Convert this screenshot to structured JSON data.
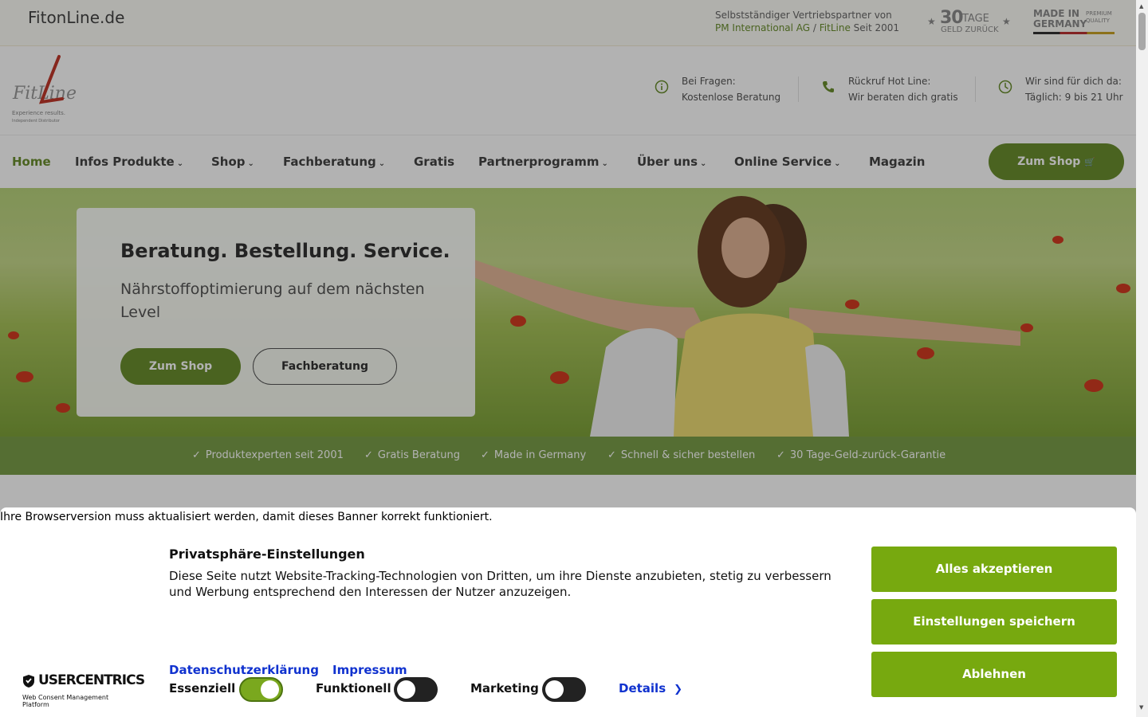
{
  "topbar": {
    "site_name": "FitonLine.de",
    "partner_line1": "Selbstständiger Vertriebspartner von",
    "partner_company": "PM International AG",
    "partner_sep": " / ",
    "partner_brand": "FitLine",
    "partner_since": " Seit 2001",
    "badge30_number": "30",
    "badge30_days": "TAGE",
    "badge30_sub": "GELD ZURÜCK",
    "made_in_l1": "MADE IN",
    "made_in_l2": "GERMANY",
    "made_in_pq1": "PREMIUM",
    "made_in_pq2": "QUALITY"
  },
  "logo": {
    "brand": "FitLine",
    "tagline1": "Experience results.",
    "tagline2": "Independent Distributor"
  },
  "header": {
    "info": [
      {
        "label": "Bei Fragen:",
        "value": "Kostenlose Beratung",
        "icon": "info-icon"
      },
      {
        "label": "Rückruf Hot Line:",
        "value": "Wir beraten dich gratis",
        "icon": "phone-icon"
      },
      {
        "label": "Wir sind für dich da:",
        "value": "Täglich: 9 bis 21 Uhr",
        "icon": "clock-icon"
      }
    ]
  },
  "nav": {
    "items": [
      {
        "label": "Home"
      },
      {
        "label": "Infos Produkte",
        "chevron": "⌄"
      },
      {
        "label": "Shop",
        "chevron": "⌄"
      },
      {
        "label": "Fachberatung",
        "chevron": "⌄"
      },
      {
        "label": "Gratis"
      },
      {
        "label": "Partnerprogramm",
        "chevron": "⌄"
      },
      {
        "label": "Über uns",
        "chevron": "⌄"
      },
      {
        "label": "Online Service",
        "chevron": "⌄"
      },
      {
        "label": "Magazin"
      }
    ],
    "shop_button": "Zum Shop",
    "cart_icon": "🛒"
  },
  "hero": {
    "title": "Beratung. Bestellung. Service.",
    "subtitle": "Nährstoffoptimierung auf dem nächsten Level",
    "primary_button": "Zum Shop",
    "secondary_button": "Fachberatung"
  },
  "usp": [
    "Produktexperten seit 2001",
    "Gratis Beratung",
    "Made in Germany",
    "Schnell & sicher bestellen",
    "30 Tage-Geld-zurück-Garantie"
  ],
  "consent": {
    "outdated_notice": "Ihre Browserversion muss aktualisiert werden, damit dieses Banner korrekt funktioniert.",
    "title": "Privatsphäre-Einstellungen",
    "text": "Diese Seite nutzt Website-Tracking-Technologien von Dritten, um ihre Dienste anzubieten, stetig zu verbessern und Werbung entsprechend den Interessen der Nutzer anzuzeigen.",
    "link_privacy": "Datenschutzerklärung",
    "link_imprint": "Impressum",
    "toggles": [
      {
        "label": "Essenziell",
        "on": true
      },
      {
        "label": "Funktionell",
        "on": false
      },
      {
        "label": "Marketing",
        "on": false
      }
    ],
    "details": "Details",
    "btn_accept": "Alles akzeptieren",
    "btn_save": "Einstellungen speichern",
    "btn_decline": "Ablehnen",
    "uc_name": "USERCENTRICS",
    "uc_sub": "Web Consent Management Platform"
  },
  "colors": {
    "brand_green": "#6a8f2e",
    "consent_green": "#77a90f",
    "link_blue": "#1032cf"
  }
}
